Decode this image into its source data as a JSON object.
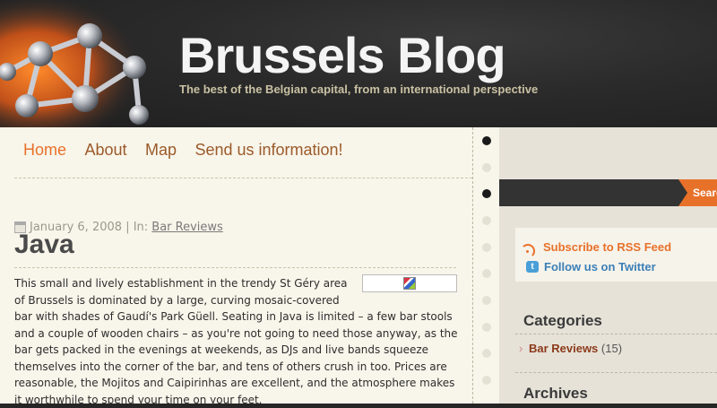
{
  "header": {
    "site_title": "Brussels Blog",
    "tagline": "The best of the Belgian capital, from an international perspective"
  },
  "nav": {
    "items": [
      {
        "label": "Home",
        "active": true
      },
      {
        "label": "About",
        "active": false
      },
      {
        "label": "Map",
        "active": false
      },
      {
        "label": "Send us information!",
        "active": false
      }
    ]
  },
  "post": {
    "date": "January 6, 2008",
    "in_label": "| In:",
    "category": "Bar Reviews",
    "title": "Java",
    "body": "This small and lively establishment in the trendy St Géry area of Brussels is dominated by a large, curving mosaic-covered bar with shades of Gaudí's Park Güell. Seating in Java is limited – a few bar stools and a couple of wooden chairs – as you're not going to need those anyway, as the bar gets packed in the evenings at weekends, as DJs and live bands squeeze themselves into the corner of the bar, and tens of others crush in too. Prices are reasonable, the Mojitos and Caipirinhas are excellent, and the atmosphere makes it worthwhile to spend your time on your feet."
  },
  "sidebar": {
    "search_label": "Search",
    "feeds": {
      "rss": "Subscribe to RSS Feed",
      "twitter": "Follow us on Twitter"
    },
    "categories": {
      "title": "Categories",
      "items": [
        {
          "name": "Bar Reviews",
          "count": "(15)"
        }
      ]
    },
    "archives": {
      "title": "Archives"
    }
  },
  "colors": {
    "accent": "#e8712a",
    "header_bg": "#262626",
    "paper": "#f8f5ea",
    "sidebar_bg": "#e6e2d8",
    "twitter": "#3b7fb8"
  }
}
